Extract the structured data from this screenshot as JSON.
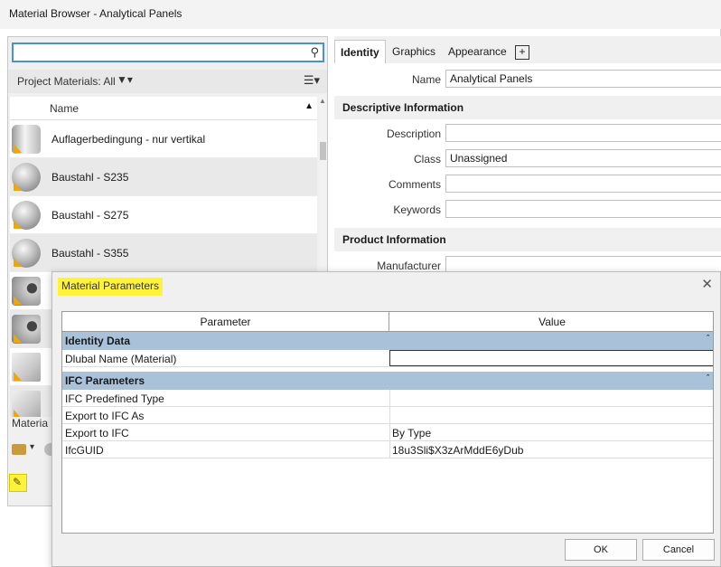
{
  "window": {
    "title": "Material Browser - Analytical Panels"
  },
  "left": {
    "search": {
      "value": "",
      "placeholder": ""
    },
    "filter_label": "Project Materials: All",
    "list_header": "Name",
    "materials": [
      {
        "label": "Auflagerbedingung - nur vertikal",
        "thumb": "cylinder"
      },
      {
        "label": "Baustahl - S235",
        "thumb": "sphere"
      },
      {
        "label": "Baustahl - S275",
        "thumb": "sphere"
      },
      {
        "label": "Baustahl - S355",
        "thumb": "sphere"
      },
      {
        "label": "",
        "thumb": "pipe"
      },
      {
        "label": "",
        "thumb": "pipe"
      },
      {
        "label": "",
        "thumb": "box"
      },
      {
        "label": "",
        "thumb": "box"
      }
    ],
    "library_label": "Materia",
    "icons": {
      "search": "search-icon",
      "filter": "filter-icon",
      "view": "list-view-icon",
      "edit": "edit-params-icon"
    }
  },
  "right": {
    "tabs": [
      {
        "label": "Identity",
        "active": true
      },
      {
        "label": "Graphics"
      },
      {
        "label": "Appearance"
      }
    ],
    "add_tab": "+",
    "name_label": "Name",
    "name_value": "Analytical Panels",
    "desc_section": "Descriptive Information",
    "description_label": "Description",
    "description_value": "",
    "class_label": "Class",
    "class_value": "Unassigned",
    "comments_label": "Comments",
    "comments_value": "",
    "keywords_label": "Keywords",
    "keywords_value": "",
    "product_section": "Product Information",
    "manufacturer_label": "Manufacturer"
  },
  "dialog": {
    "title": "Material Parameters",
    "col_param": "Parameter",
    "col_value": "Value",
    "groups": [
      {
        "name": "Identity Data",
        "rows": [
          {
            "param": "Dlubal Name (Material)",
            "value": ""
          }
        ]
      },
      {
        "name": "IFC Parameters",
        "rows": [
          {
            "param": "IFC Predefined Type",
            "value": ""
          },
          {
            "param": "Export to IFC As",
            "value": ""
          },
          {
            "param": "Export to IFC",
            "value": "By Type"
          },
          {
            "param": "IfcGUID",
            "value": "18u3Sli$X3zArMddE6yDub"
          }
        ]
      }
    ],
    "ok_label": "OK",
    "cancel_label": "Cancel",
    "highlight_color": "#fff33a",
    "group_color": "#a9c1d9"
  }
}
